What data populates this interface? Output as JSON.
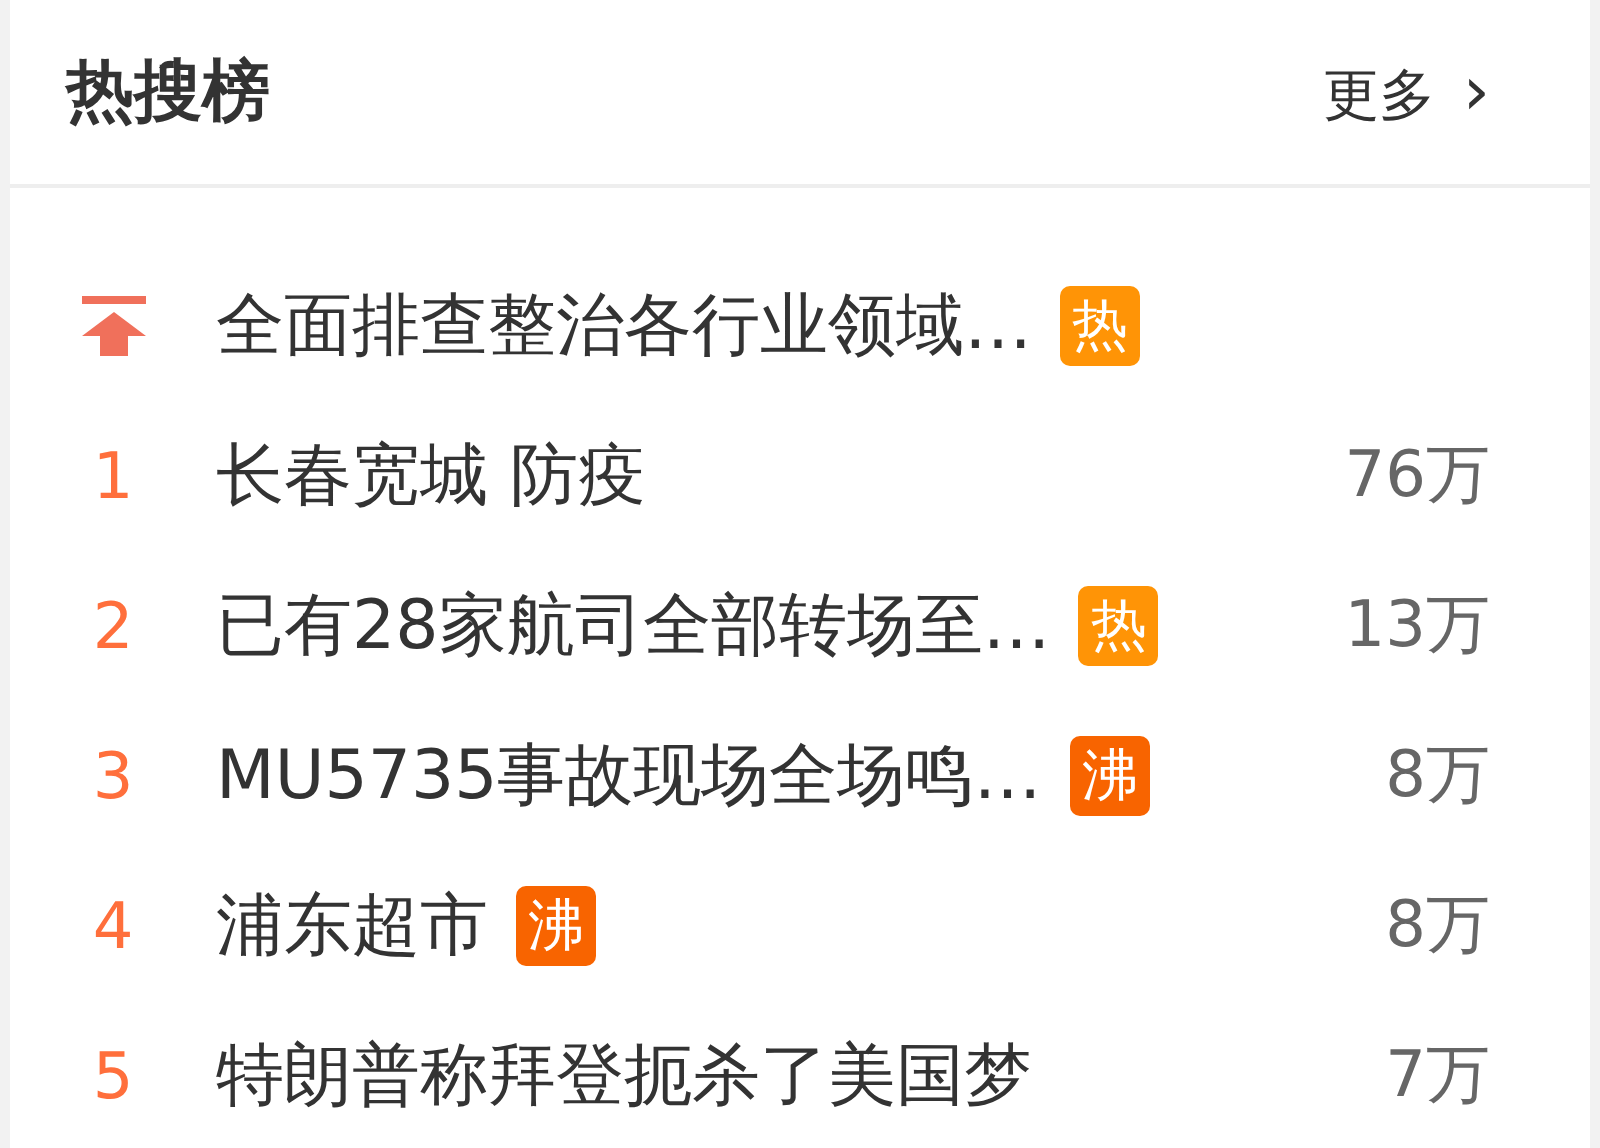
{
  "panel": {
    "title": "热搜榜",
    "more_link": "更多",
    "more_arrow": "›"
  },
  "items": [
    {
      "kind": "pinned",
      "title": "全面排查整治各行业领域…",
      "badge": {
        "text": "热",
        "color": "#ff9406"
      }
    },
    {
      "kind": "ranked",
      "rank": "1",
      "title": "长春宽城 防疫",
      "count": "76万"
    },
    {
      "kind": "ranked",
      "rank": "2",
      "title": "已有28家航司全部转场至…",
      "badge": {
        "text": "热",
        "color": "#ff9406"
      },
      "count": "13万"
    },
    {
      "kind": "ranked",
      "rank": "3",
      "title": "MU5735事故现场全场鸣…",
      "badge": {
        "text": "沸",
        "color": "#f86400"
      },
      "count": "8万"
    },
    {
      "kind": "ranked",
      "rank": "4",
      "title": "浦东超市",
      "badge": {
        "text": "沸",
        "color": "#f86400"
      },
      "count": "8万"
    },
    {
      "kind": "ranked",
      "rank": "5",
      "title": "特朗普称拜登扼杀了美国梦",
      "count": "7万"
    }
  ]
}
